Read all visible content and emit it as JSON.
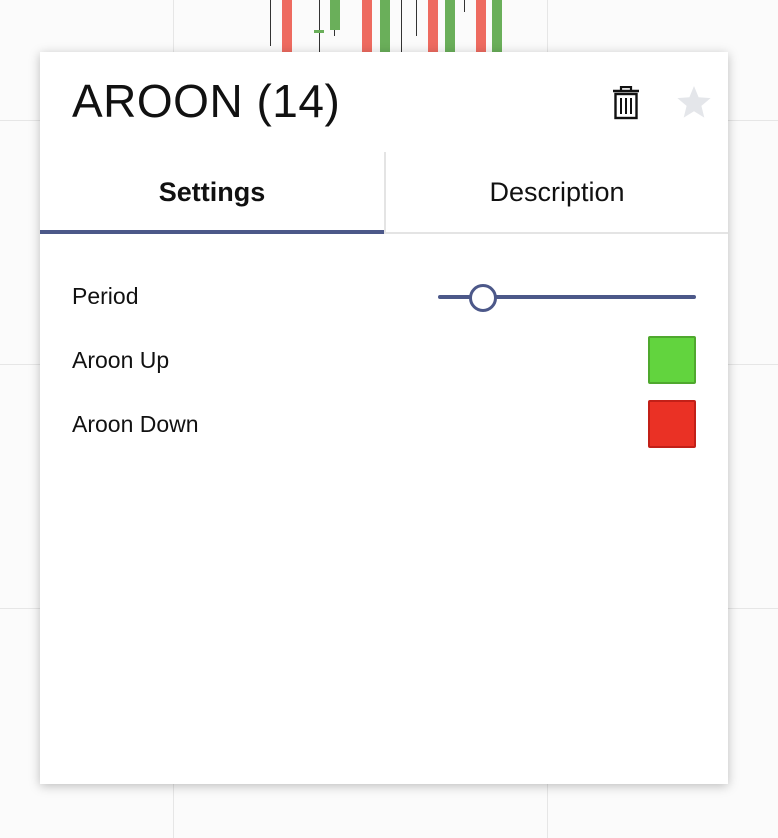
{
  "indicator": {
    "title": "AROON (14)",
    "period": 14,
    "period_fraction": 0.17
  },
  "icons": {
    "delete": "trash-icon",
    "favorite": "star-icon"
  },
  "tabs": [
    {
      "label": "Settings",
      "active": true
    },
    {
      "label": "Description",
      "active": false
    }
  ],
  "settings": {
    "period_label": "Period",
    "aroon_up_label": "Aroon Up",
    "aroon_down_label": "Aroon Down"
  },
  "colors": {
    "accent": "#4c5889",
    "aroon_up": "#62d43e",
    "aroon_up_border": "#4fa82e",
    "aroon_down": "#ea3125",
    "aroon_down_border": "#c22018",
    "candle_up": "#6aaf5a",
    "candle_down": "#ee6b60"
  }
}
